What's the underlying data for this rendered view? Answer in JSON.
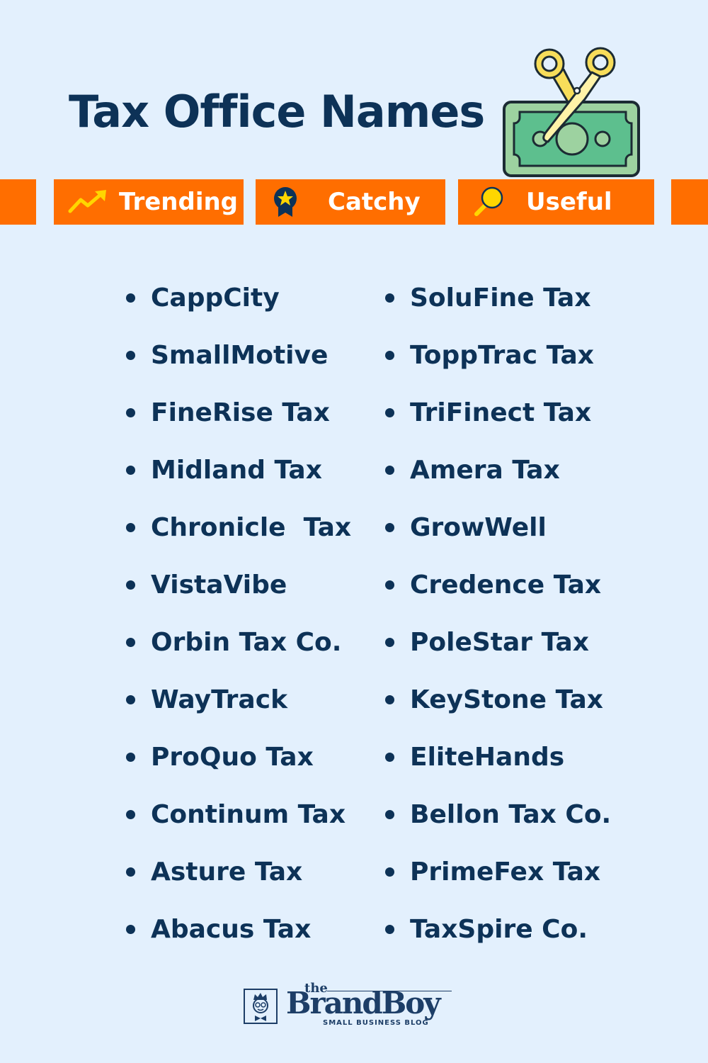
{
  "header": {
    "title": "Tax Office Names",
    "illustration": "money-scissors-icon"
  },
  "tags": [
    {
      "label": "Trending",
      "icon": "trending-up-icon"
    },
    {
      "label": "Catchy",
      "icon": "award-ribbon-icon"
    },
    {
      "label": "Useful",
      "icon": "magnifier-icon"
    }
  ],
  "colors": {
    "background": "#e3f0fd",
    "accent": "#ff6e00",
    "text": "#0d3257",
    "icon_yellow": "#ffd600"
  },
  "names": {
    "left": [
      "CappCity",
      "SmallMotive",
      "FineRise Tax",
      "Midland Tax",
      "Chronicle  Tax",
      "VistaVibe",
      "Orbin Tax Co.",
      "WayTrack",
      "ProQuo Tax",
      "Continum Tax",
      "Asture Tax",
      "Abacus Tax"
    ],
    "right": [
      "SoluFine Tax",
      "ToppTrac Tax",
      "TriFinect Tax",
      "Amera Tax",
      "GrowWell",
      "Credence Tax",
      "PoleStar Tax",
      "KeyStone Tax",
      "EliteHands",
      "Bellon Tax Co.",
      "PrimeFex Tax",
      "TaxSpire Co."
    ]
  },
  "footer": {
    "logo_the": "the",
    "logo_brand": "BrandBoy",
    "logo_sub": "SMALL BUSINESS BLOG"
  }
}
